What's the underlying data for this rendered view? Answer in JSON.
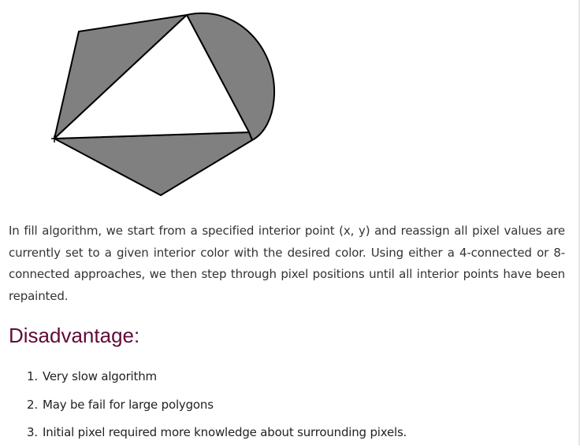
{
  "figure": {
    "fill_color": "#808080",
    "stroke_color": "#000000",
    "background": "#ffffff"
  },
  "paragraph": "In fill algorithm, we start from a specified interior point (x, y) and reassign all pixel values are currently set to a given interior color with the desired color. Using either a 4-connected or 8-connected approaches, we then step through pixel positions until all interior points have been repainted.",
  "heading": "Disadvantage:",
  "list": [
    {
      "number": "1.",
      "text": "Very slow algorithm"
    },
    {
      "number": "2.",
      "text": "May be fail for large polygons"
    },
    {
      "number": "3.",
      "text": "Initial pixel required more knowledge about surrounding pixels."
    }
  ],
  "colors": {
    "heading": "#610b38",
    "body_text": "#333333"
  }
}
